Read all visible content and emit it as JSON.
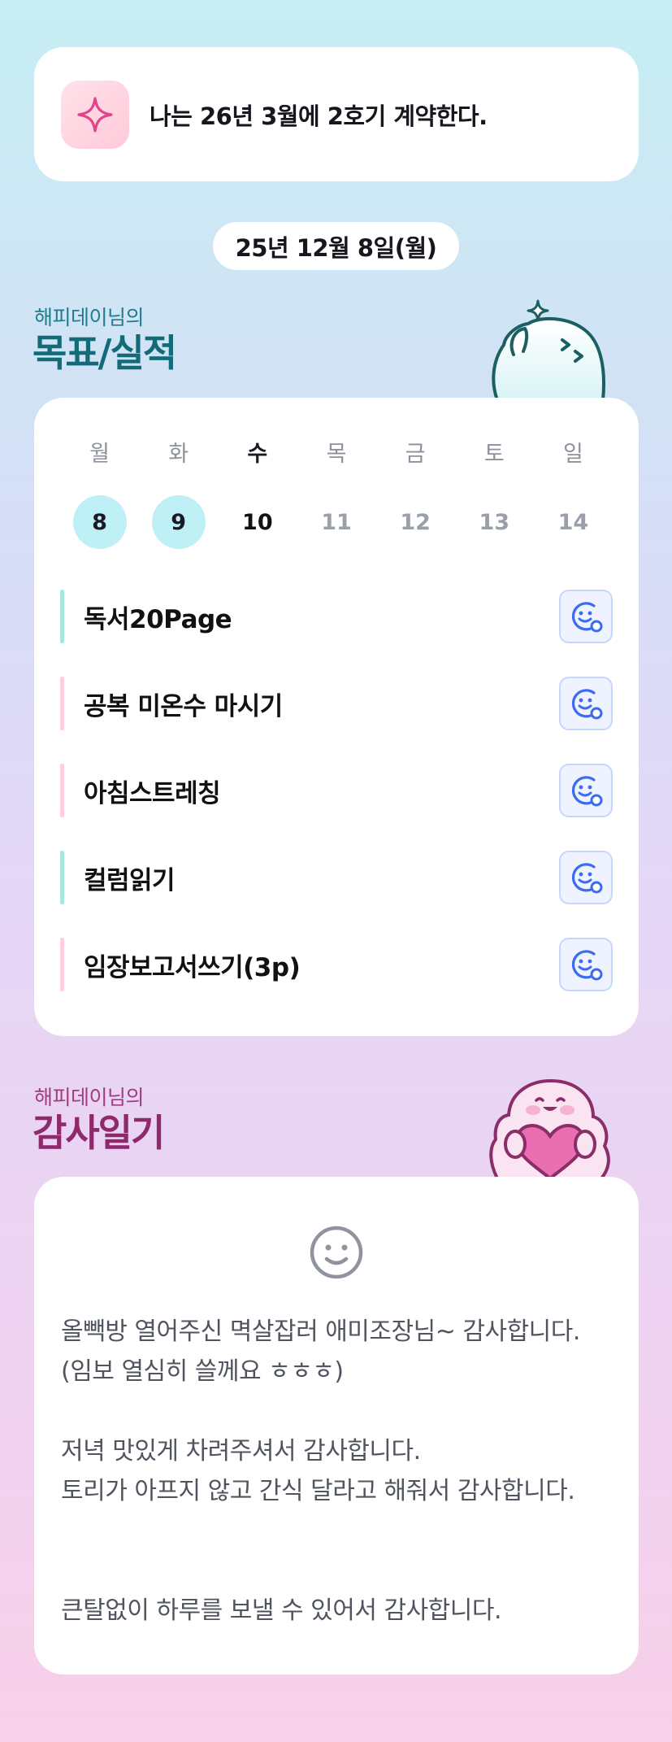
{
  "goal_banner": {
    "text": "나는 26년 3월에 2호기 계약한다.",
    "icon": "sparkle-icon"
  },
  "date_pill": "25년 12월 8일(월)",
  "goals_section": {
    "subtitle": "해피데이님의",
    "title": "목표/실적"
  },
  "week": {
    "days": [
      {
        "label": "월",
        "date": "8",
        "state": "done"
      },
      {
        "label": "화",
        "date": "9",
        "state": "done"
      },
      {
        "label": "수",
        "date": "10",
        "state": "today"
      },
      {
        "label": "목",
        "date": "11",
        "state": "future"
      },
      {
        "label": "금",
        "date": "12",
        "state": "future"
      },
      {
        "label": "토",
        "date": "13",
        "state": "future"
      },
      {
        "label": "일",
        "date": "14",
        "state": "future"
      }
    ]
  },
  "tasks": [
    {
      "label": "독서20Page",
      "color": "#a6e8dd"
    },
    {
      "label": "공복 미온수 마시기",
      "color": "#ffcfe0"
    },
    {
      "label": "아침스트레칭",
      "color": "#ffcfe0"
    },
    {
      "label": "컬럼읽기",
      "color": "#a6e8dd"
    },
    {
      "label": "임장보고서쓰기(3p)",
      "color": "#ffcfe0"
    }
  ],
  "thanks_section": {
    "subtitle": "해피데이님의",
    "title": "감사일기",
    "icon": "smile-icon",
    "lines": [
      "올빽방 열어주신 멱살잡러 애미조장님~ 감사합니다.",
      "(임보 열심히 쓸께요 ㅎㅎㅎ)",
      "",
      "저녁 맛있게 차려주셔서 감사합니다.",
      "토리가 아프지 않고 간식 달라고 해줘서 감사합니다.",
      "",
      "",
      "큰탈없이 하루를 보낼 수 있어서 감사합니다."
    ]
  },
  "colors": {
    "accent_teal": "#136b78",
    "accent_magenta": "#8e2a6b",
    "check_blue": "#3b6cf0"
  }
}
